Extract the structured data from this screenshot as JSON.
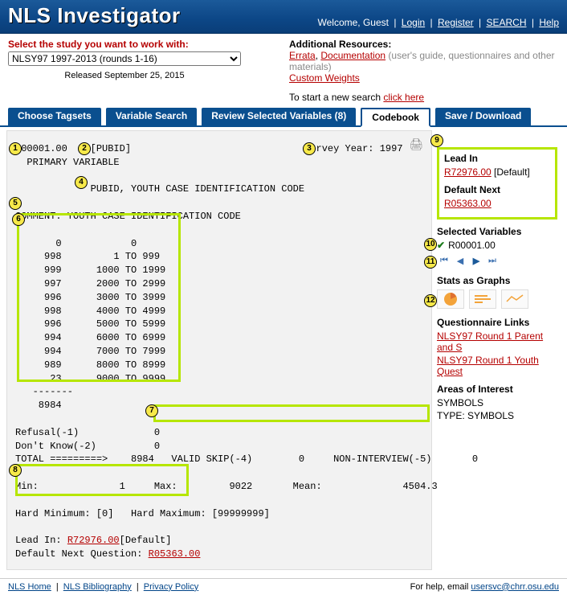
{
  "header": {
    "title_pre": "NLS ",
    "title_main": "Investigator",
    "welcome": "Welcome, Guest",
    "links": {
      "login": "Login",
      "register": "Register",
      "search": "SEARCH",
      "help": "Help"
    }
  },
  "study": {
    "label": "Select the study you want to work with:",
    "selected": "NLSY97 1997-2013 (rounds 1-16)",
    "released": "Released September 25, 2015"
  },
  "resources": {
    "title": "Additional Resources:",
    "errata": "Errata",
    "doc": "Documentation",
    "doc_note": "(user's guide, questionnaires and other materials)",
    "weights": "Custom Weights",
    "start": "To start a new search ",
    "click": "click here"
  },
  "tabs": {
    "tagsets": "Choose Tagsets",
    "varsearch": "Variable Search",
    "review": "Review Selected Variables (8)",
    "codebook": "Codebook",
    "save": "Save / Download"
  },
  "code": {
    "rnum": "R00001.00",
    "pubid": "[PUBID]",
    "survey": "Survey Year: 1997",
    "primary": "PRIMARY VARIABLE",
    "title": "PUBID, YOUTH CASE IDENTIFICATION CODE",
    "comment": "COMMENT: YOUTH CASE IDENTIFICATION CODE",
    "dist": "       0            0\n     998         1 TO 999\n     999      1000 TO 1999\n     997      2000 TO 2999\n     996      3000 TO 3999\n     998      4000 TO 4999\n     996      5000 TO 5999\n     994      6000 TO 6999\n     994      7000 TO 7999\n     989      8000 TO 8999\n      23      9000 TO 9999\n   -------\n    8984",
    "refusal": "Refusal(-1)             0",
    "dk": "Don't Know(-2)          0",
    "totline": "TOTAL =========>    8984   VALID SKIP(-4)        0     NON-INTERVIEW(-5)       0",
    "stats": "Min:              1     Max:         9022       Mean:              4504.3",
    "hard": "Hard Minimum: [0]   Hard Maximum: [99999999]",
    "leadin_pre": "Lead In: ",
    "leadin_link": "R72976.00",
    "leadin_post": "[Default]",
    "defnext_pre": "Default Next Question: ",
    "defnext_link": "R05363.00"
  },
  "side": {
    "leadin_h": "Lead In",
    "leadin_link": "R72976.00",
    "leadin_def": " [Default]",
    "defnext_h": "Default Next",
    "defnext_link": "R05363.00",
    "selvar_h": "Selected Variables",
    "selvar": "R00001.00",
    "stats_h": "Stats as Graphs",
    "qlinks_h": "Questionnaire Links",
    "ql1": "NLSY97 Round 1 Parent and S",
    "ql2": "NLSY97 Round 1 Youth Quest",
    "aoi_h": "Areas of Interest",
    "aoi1": "SYMBOLS",
    "aoi2": "TYPE: SYMBOLS"
  },
  "footer": {
    "l1": "NLS Home",
    "l2": "NLS Bibliography",
    "l3": "Privacy Policy",
    "help": "For help, email ",
    "email": "usersvc@chrr.osu.edu"
  },
  "callouts": [
    "1",
    "2",
    "3",
    "4",
    "5",
    "6",
    "7",
    "8",
    "9",
    "10",
    "11",
    "12"
  ]
}
